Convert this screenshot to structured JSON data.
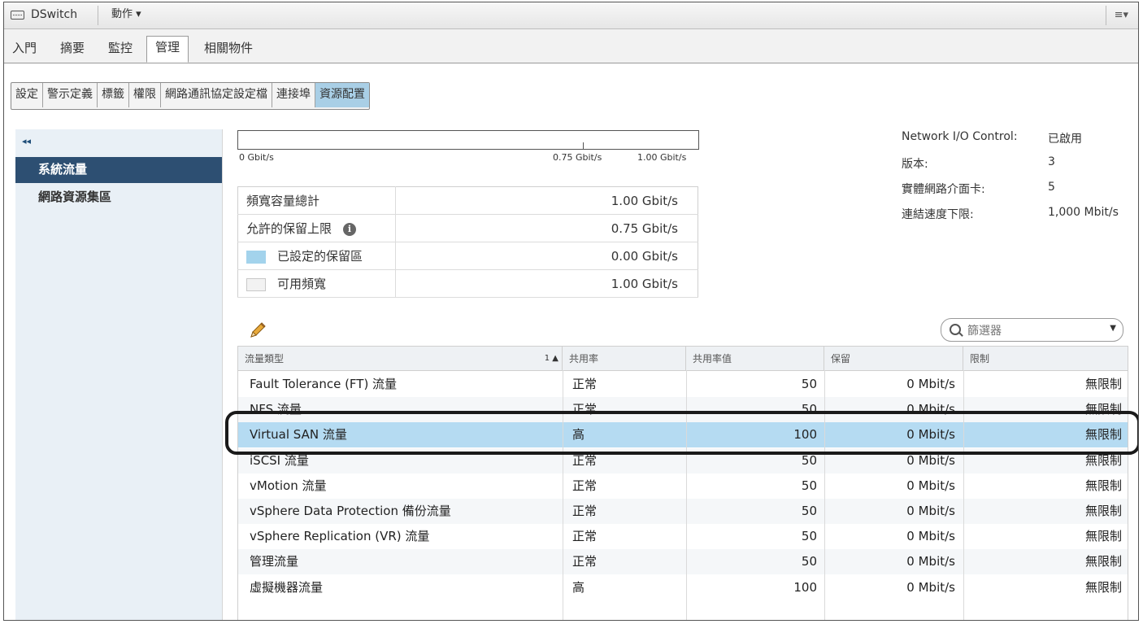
{
  "titlebar": {
    "title": "DSwitch",
    "actions": "動作 ▾",
    "menu_glyph": "≡▾"
  },
  "tabs": [
    {
      "label": "入門"
    },
    {
      "label": "摘要"
    },
    {
      "label": "監控"
    },
    {
      "label": "管理"
    },
    {
      "label": "相關物件"
    }
  ],
  "subtabs": [
    {
      "label": "設定"
    },
    {
      "label": "警示定義"
    },
    {
      "label": "標籤"
    },
    {
      "label": "權限"
    },
    {
      "label": "網路通訊協定設定檔"
    },
    {
      "label": "連接埠"
    },
    {
      "label": "資源配置"
    }
  ],
  "nav": {
    "collapse": "◂◂",
    "items": [
      {
        "label": "系統流量"
      },
      {
        "label": "網路資源集區"
      }
    ]
  },
  "bandwidth_bar": {
    "labels": [
      "0 Gbit/s",
      "0.75 Gbit/s",
      "1.00 Gbit/s"
    ]
  },
  "summary": [
    {
      "label": "頻寬容量總計",
      "value": "1.00 Gbit/s"
    },
    {
      "label": "允許的保留上限",
      "value": "0.75 Gbit/s"
    },
    {
      "label": "已設定的保留區",
      "value": "0.00 Gbit/s"
    },
    {
      "label": "可用頻寬",
      "value": "1.00 Gbit/s"
    }
  ],
  "info_icon": "i",
  "info": [
    {
      "key": "Network I/O Control:",
      "value": "已啟用"
    },
    {
      "key": "版本:",
      "value": "3"
    },
    {
      "key": "實體網路介面卡:",
      "value": "5"
    },
    {
      "key": "連結速度下限:",
      "value": "1,000 Mbit/s"
    }
  ],
  "filter": {
    "placeholder": "篩選器"
  },
  "grid": {
    "headers": [
      "流量類型",
      "共用率",
      "共用率值",
      "保留",
      "限制"
    ],
    "sort": "1 ▲",
    "rows": [
      {
        "type": "Fault Tolerance (FT) 流量",
        "share": "正常",
        "value": "50",
        "reserve": "0 Mbit/s",
        "limit": "無限制"
      },
      {
        "type": "NFS 流量",
        "share": "正常",
        "value": "50",
        "reserve": "0 Mbit/s",
        "limit": "無限制"
      },
      {
        "type": "Virtual SAN 流量",
        "share": "高",
        "value": "100",
        "reserve": "0 Mbit/s",
        "limit": "無限制"
      },
      {
        "type": "iSCSI 流量",
        "share": "正常",
        "value": "50",
        "reserve": "0 Mbit/s",
        "limit": "無限制"
      },
      {
        "type": "vMotion 流量",
        "share": "正常",
        "value": "50",
        "reserve": "0 Mbit/s",
        "limit": "無限制"
      },
      {
        "type": "vSphere Data Protection 備份流量",
        "share": "正常",
        "value": "50",
        "reserve": "0 Mbit/s",
        "limit": "無限制"
      },
      {
        "type": "vSphere Replication (VR) 流量",
        "share": "正常",
        "value": "50",
        "reserve": "0 Mbit/s",
        "limit": "無限制"
      },
      {
        "type": "管理流量",
        "share": "正常",
        "value": "50",
        "reserve": "0 Mbit/s",
        "limit": "無限制"
      },
      {
        "type": "虛擬機器流量",
        "share": "高",
        "value": "100",
        "reserve": "0 Mbit/s",
        "limit": "無限制"
      }
    ]
  },
  "colors": {
    "selected_row": "#b5dbf2",
    "nav_active": "#2d4f72",
    "reserved_swatch": "#a3d3ec"
  }
}
